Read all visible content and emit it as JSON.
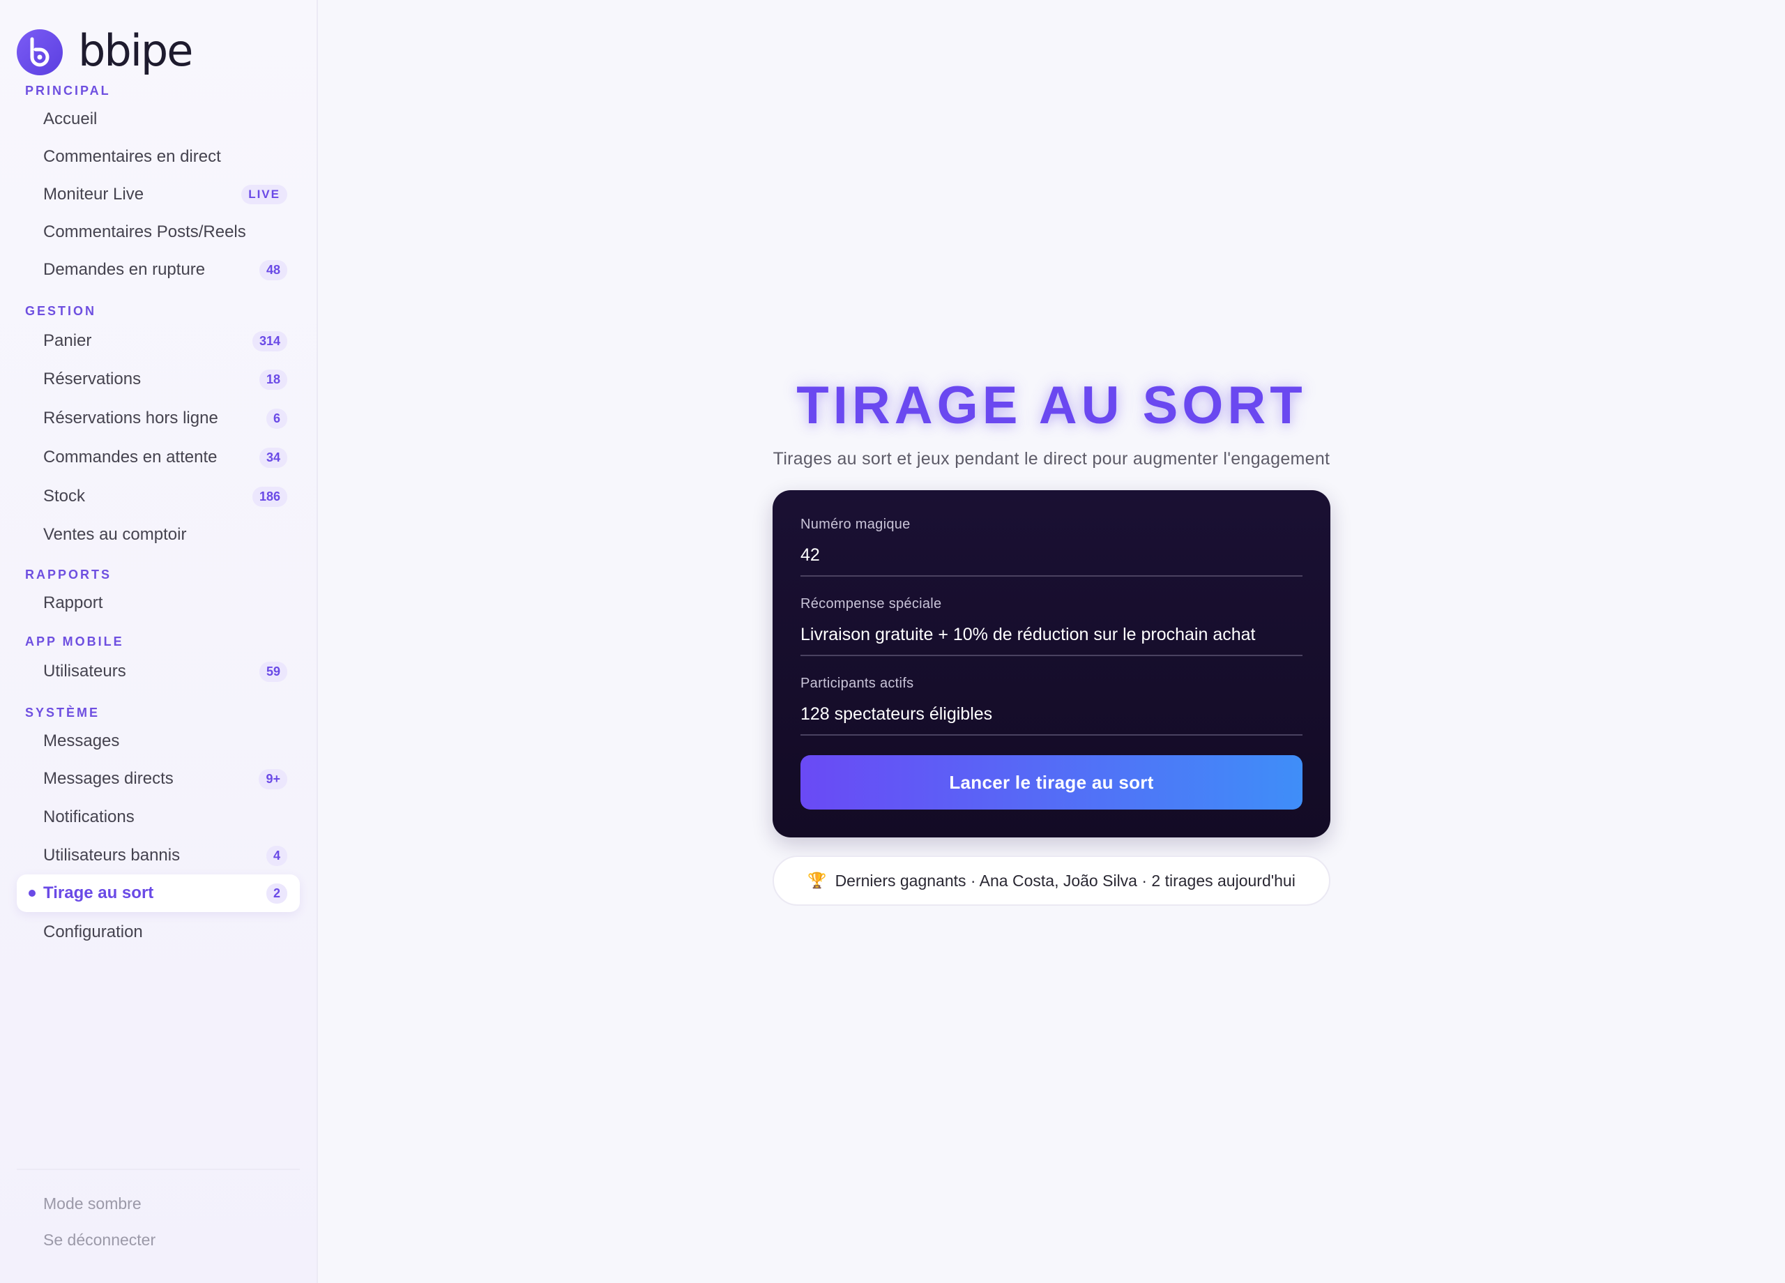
{
  "brand": {
    "name": "bbipe"
  },
  "sidebar": {
    "sections": [
      {
        "title": "PRINCIPAL",
        "items": [
          {
            "label": "Accueil",
            "badge": ""
          },
          {
            "label": "Commentaires en direct",
            "badge": ""
          },
          {
            "label": "Moniteur Live",
            "badge": "LIVE"
          },
          {
            "label": "Commentaires Posts/Reels",
            "badge": ""
          },
          {
            "label": "Demandes en rupture",
            "badge": "48"
          }
        ]
      },
      {
        "title": "GESTION",
        "items": [
          {
            "label": "Panier",
            "badge": "314"
          },
          {
            "label": "Réservations",
            "badge": "18"
          },
          {
            "label": "Réservations hors ligne",
            "badge": "6"
          },
          {
            "label": "Commandes en attente",
            "badge": "34"
          },
          {
            "label": "Stock",
            "badge": "186"
          },
          {
            "label": "Ventes au comptoir",
            "badge": ""
          }
        ]
      },
      {
        "title": "RAPPORTS",
        "items": [
          {
            "label": "Rapport",
            "badge": ""
          }
        ]
      },
      {
        "title": "APP MOBILE",
        "items": [
          {
            "label": "Utilisateurs",
            "badge": "59"
          }
        ]
      },
      {
        "title": "SYSTÈME",
        "items": [
          {
            "label": "Messages",
            "badge": ""
          },
          {
            "label": "Messages directs",
            "badge": "9+"
          },
          {
            "label": "Notifications",
            "badge": ""
          },
          {
            "label": "Utilisateurs bannis",
            "badge": "4"
          },
          {
            "label": "Tirage au sort",
            "badge": "2"
          },
          {
            "label": "Configuration",
            "badge": ""
          }
        ]
      }
    ],
    "footer": {
      "dark_mode_label": "Mode sombre",
      "logout_label": "Se déconnecter"
    }
  },
  "main": {
    "title": "TIRAGE AU SORT",
    "subtitle": "Tirages au sort et jeux pendant le direct pour augmenter l'engagement",
    "card": {
      "fields": [
        {
          "label": "Numéro magique",
          "value": "42"
        },
        {
          "label": "Récompense spéciale",
          "value": "Livraison gratuite + 10% de réduction sur le prochain achat"
        },
        {
          "label": "Participants actifs",
          "value": "128 spectateurs éligibles"
        }
      ],
      "button_label": "Lancer le tirage au sort"
    },
    "winners_text": "Derniers gagnants · Ana Costa, João Silva · 2 tirages aujourd'hui"
  },
  "colors": {
    "accent": "#6a4ae6",
    "card_bg": "#170e2c",
    "button_gradient_start": "#6a4af5",
    "button_gradient_end": "#3f8ef8"
  }
}
